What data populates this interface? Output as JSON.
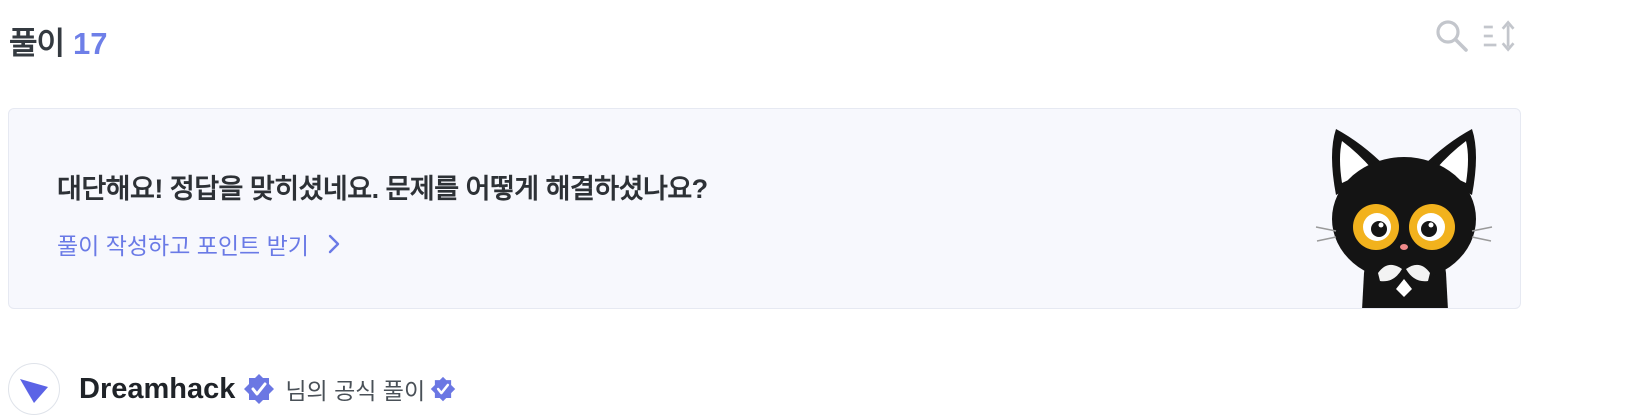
{
  "header": {
    "title": "풀이",
    "count": "17"
  },
  "tools": {
    "search_icon": "search-icon",
    "sort_icon": "sort-icon"
  },
  "promo": {
    "message": "대단해요! 정답을 맞히셨네요. 문제를 어떻게 해결하셨나요?",
    "cta_label": "풀이 작성하고 포인트 받기"
  },
  "author": {
    "name": "Dreamhack",
    "suffix": "님의 공식 풀이"
  },
  "colors": {
    "accent": "#6e7fe8",
    "card_bg": "#f7f8fd",
    "icon_gray": "#c3c6cc"
  }
}
